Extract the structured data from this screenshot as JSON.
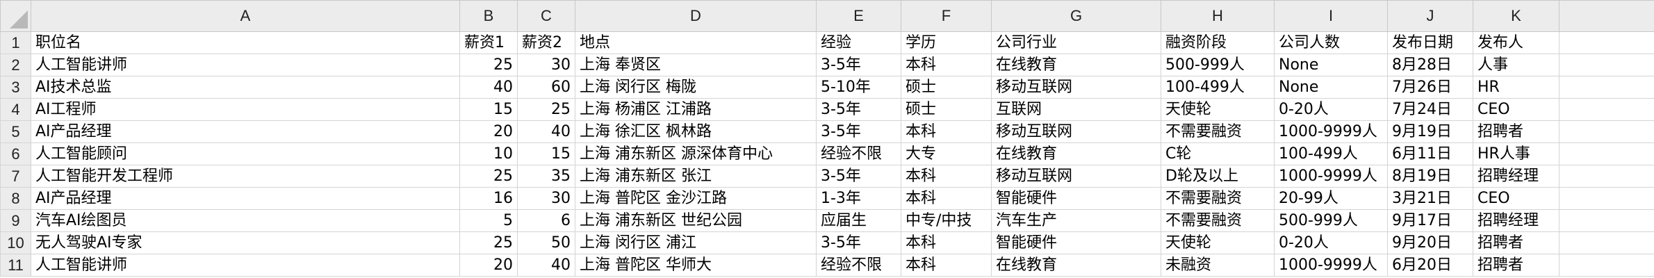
{
  "columns": [
    "A",
    "B",
    "C",
    "D",
    "E",
    "F",
    "G",
    "H",
    "I",
    "J",
    "K"
  ],
  "row_numbers": [
    "1",
    "2",
    "3",
    "4",
    "5",
    "6",
    "7",
    "8",
    "9",
    "10",
    "11"
  ],
  "header_row": [
    "职位名",
    "薪资1",
    "薪资2",
    "地点",
    "经验",
    "学历",
    "公司行业",
    "融资阶段",
    "公司人数",
    "发布日期",
    "发布人"
  ],
  "rows": [
    [
      "人工智能讲师",
      "25",
      "30",
      "上海 奉贤区",
      "3-5年",
      "本科",
      "在线教育",
      "500-999人",
      "None",
      "8月28日",
      "人事"
    ],
    [
      "AI技术总监",
      "40",
      "60",
      "上海 闵行区 梅陇",
      "5-10年",
      "硕士",
      "移动互联网",
      "100-499人",
      "None",
      "7月26日",
      "HR"
    ],
    [
      "AI工程师",
      "15",
      "25",
      "上海 杨浦区 江浦路",
      "3-5年",
      "硕士",
      "互联网",
      "天使轮",
      "0-20人",
      "7月24日",
      "CEO"
    ],
    [
      "AI产品经理",
      "20",
      "40",
      "上海 徐汇区 枫林路",
      "3-5年",
      "本科",
      "移动互联网",
      "不需要融资",
      "1000-9999人",
      "9月19日",
      "招聘者"
    ],
    [
      "人工智能顾问",
      "10",
      "15",
      "上海 浦东新区 源深体育中心",
      "经验不限",
      "大专",
      "在线教育",
      "C轮",
      "100-499人",
      "6月11日",
      "HR人事"
    ],
    [
      "人工智能开发工程师",
      "25",
      "35",
      "上海 浦东新区 张江",
      "3-5年",
      "本科",
      "移动互联网",
      "D轮及以上",
      "1000-9999人",
      "8月19日",
      "招聘经理"
    ],
    [
      "AI产品经理",
      "16",
      "30",
      "上海 普陀区 金沙江路",
      "1-3年",
      "本科",
      "智能硬件",
      "不需要融资",
      "20-99人",
      "3月21日",
      "CEO"
    ],
    [
      "汽车AI绘图员",
      "5",
      "6",
      "上海 浦东新区 世纪公园",
      "应届生",
      "中专/中技",
      "汽车生产",
      "不需要融资",
      "500-999人",
      "9月17日",
      "招聘经理"
    ],
    [
      "无人驾驶AI专家",
      "25",
      "50",
      "上海 闵行区 浦江",
      "3-5年",
      "本科",
      "智能硬件",
      "天使轮",
      "0-20人",
      "9月20日",
      "招聘者"
    ],
    [
      "人工智能讲师",
      "20",
      "40",
      "上海 普陀区 华师大",
      "经验不限",
      "本科",
      "在线教育",
      "未融资",
      "1000-9999人",
      "6月20日",
      "招聘者"
    ]
  ]
}
